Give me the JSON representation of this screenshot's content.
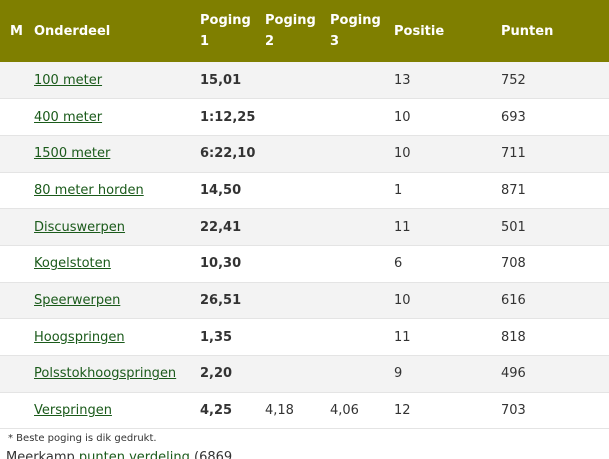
{
  "table": {
    "headers": {
      "m": "M",
      "name": "Onderdeel",
      "p1_a": "Poging",
      "p1_b": "1",
      "p2_a": "Poging",
      "p2_b": "2",
      "p3_a": "Poging",
      "p3_b": "3",
      "pos": "Positie",
      "pts": "Punten"
    },
    "rows": [
      {
        "name": "100 meter",
        "p1": "15,01",
        "p2": "",
        "p3": "",
        "pos": "13",
        "pts": "752"
      },
      {
        "name": "400 meter",
        "p1": "1:12,25",
        "p2": "",
        "p3": "",
        "pos": "10",
        "pts": "693"
      },
      {
        "name": "1500 meter",
        "p1": "6:22,10",
        "p2": "",
        "p3": "",
        "pos": "10",
        "pts": "711"
      },
      {
        "name": "80 meter horden",
        "p1": "14,50",
        "p2": "",
        "p3": "",
        "pos": "1",
        "pts": "871"
      },
      {
        "name": "Discuswerpen",
        "p1": "22,41",
        "p2": "",
        "p3": "",
        "pos": "11",
        "pts": "501"
      },
      {
        "name": "Kogelstoten",
        "p1": "10,30",
        "p2": "",
        "p3": "",
        "pos": "6",
        "pts": "708"
      },
      {
        "name": "Speerwerpen",
        "p1": "26,51",
        "p2": "",
        "p3": "",
        "pos": "10",
        "pts": "616"
      },
      {
        "name": "Hoogspringen",
        "p1": "1,35",
        "p2": "",
        "p3": "",
        "pos": "11",
        "pts": "818"
      },
      {
        "name": "Polsstokhoogspringen",
        "p1": "2,20",
        "p2": "",
        "p3": "",
        "pos": "9",
        "pts": "496"
      },
      {
        "name": "Verspringen",
        "p1": "4,25",
        "p2": "4,18",
        "p3": "4,06",
        "pos": "12",
        "pts": "703"
      }
    ]
  },
  "footnote": "* Beste poging is dik gedrukt.",
  "summary": {
    "prefix": "Meerkamp ",
    "link": "punten verdeling",
    "suffix": " (6869"
  },
  "colors": {
    "header_bg": "#7f7f00",
    "header_text": "#ffffff",
    "link": "#1a5a1a",
    "row_alt": "#f3f3f3"
  }
}
